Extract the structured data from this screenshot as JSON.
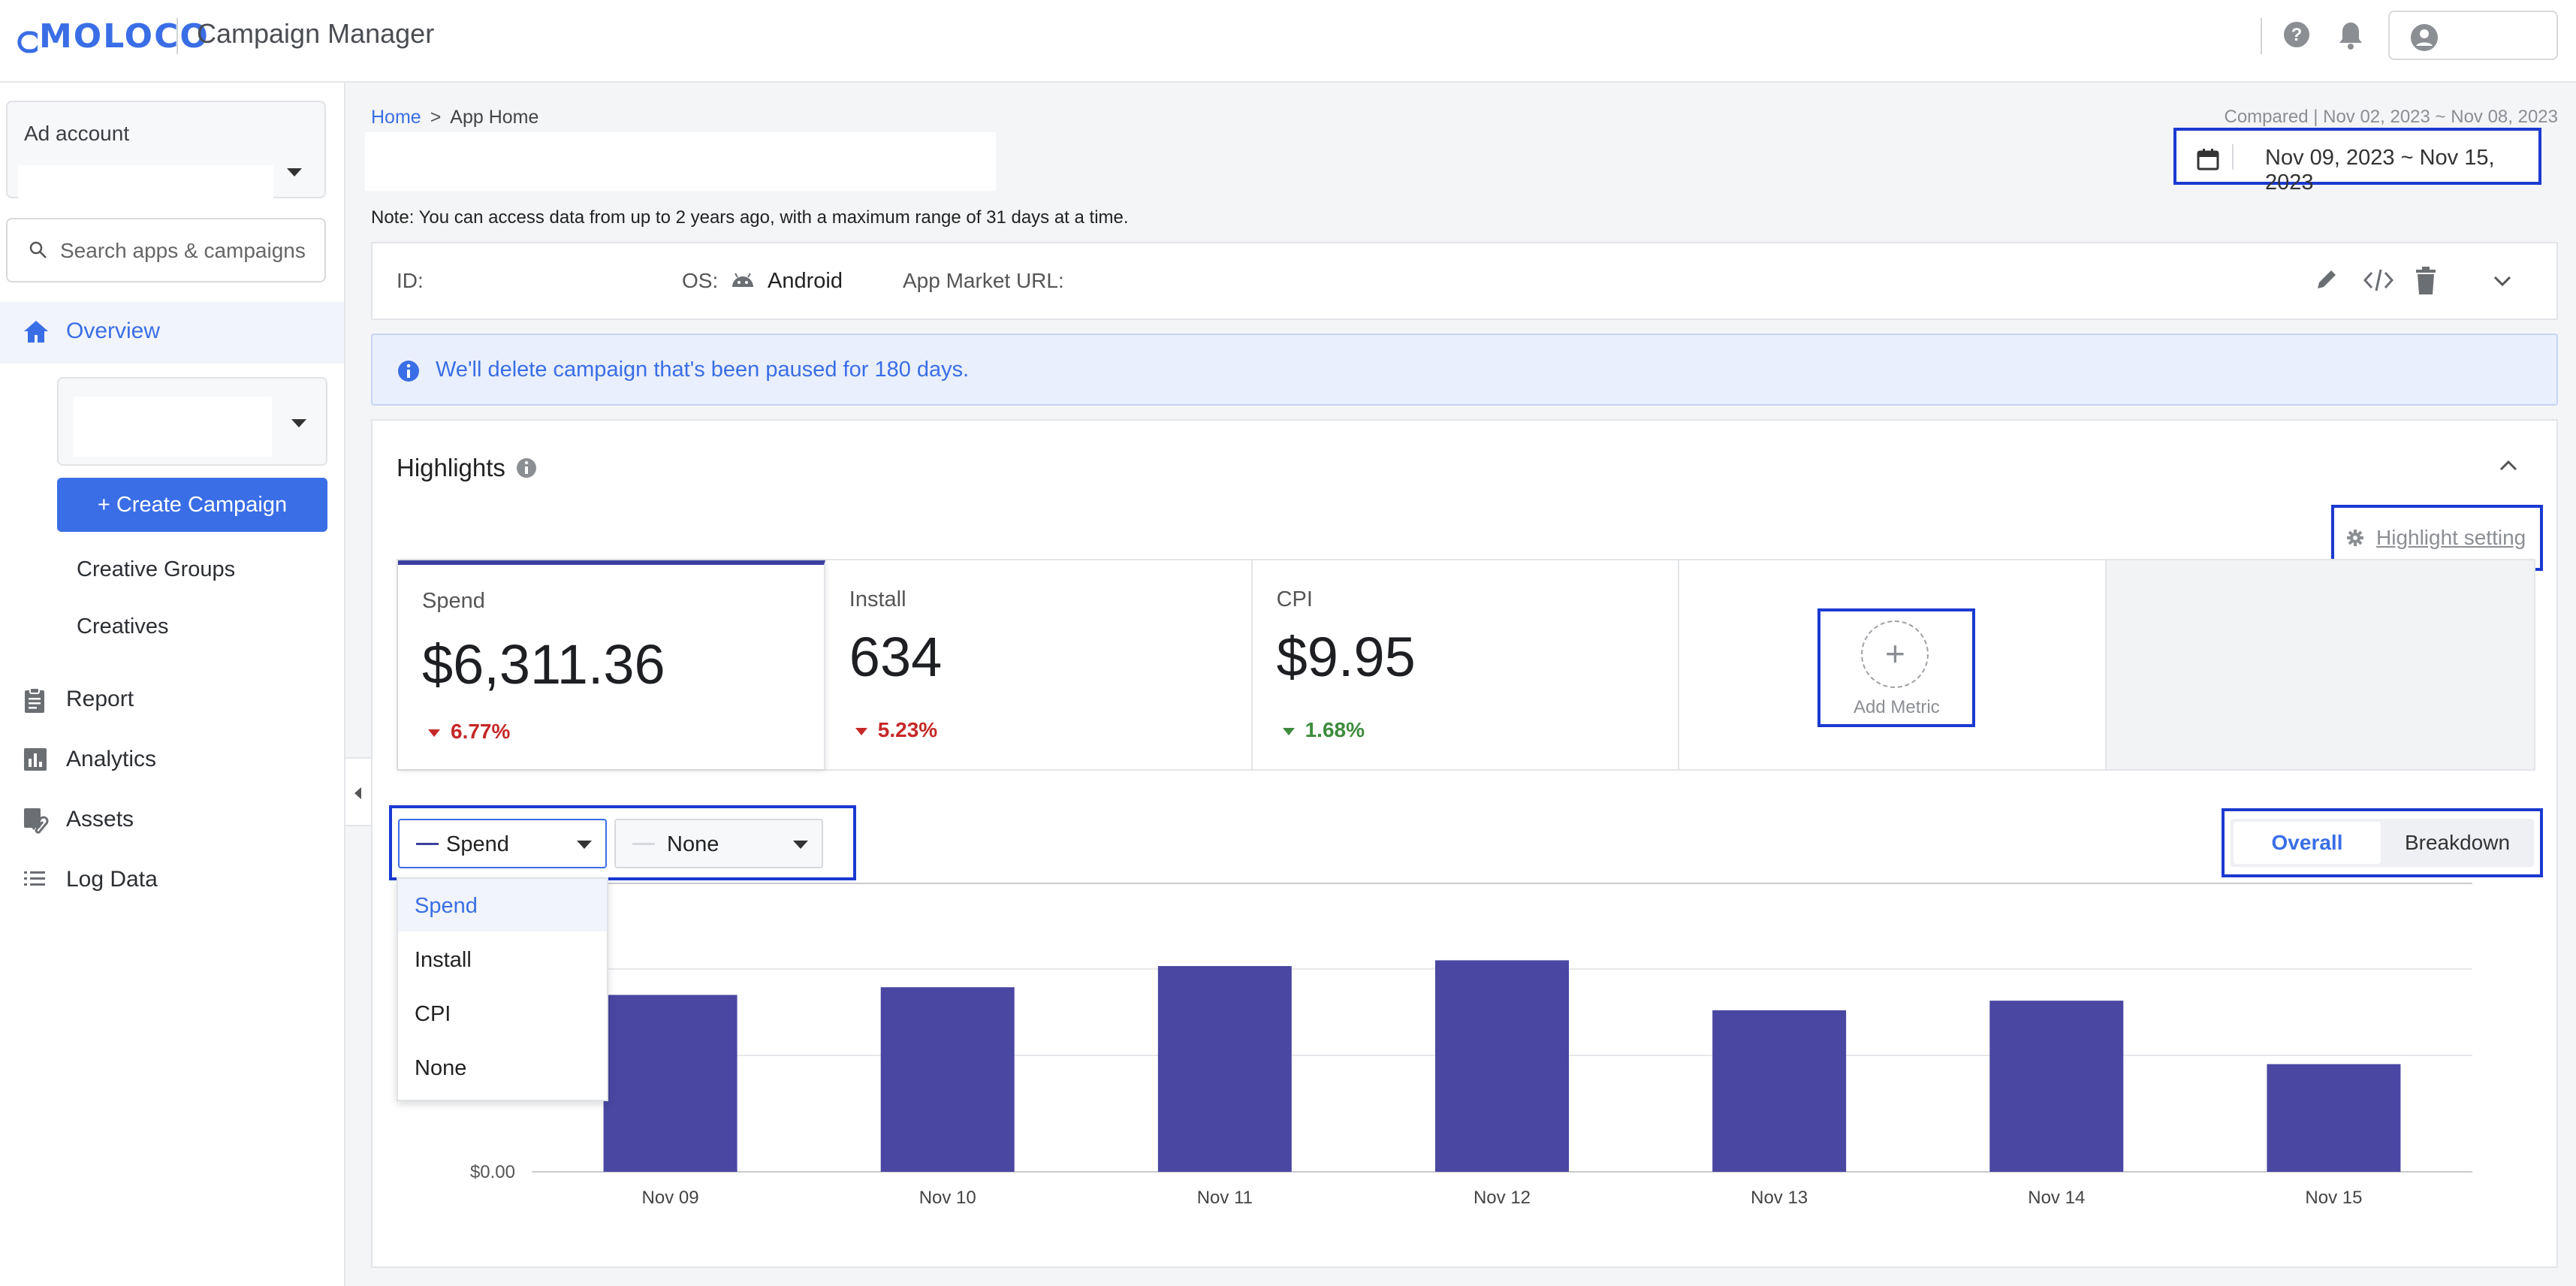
{
  "header": {
    "brand": "MOLOCO",
    "app_title": "Campaign Manager"
  },
  "sidebar": {
    "ad_account_label": "Ad account",
    "search_placeholder": "Search apps & campaigns",
    "overview_label": "Overview",
    "create_campaign_label": "+ Create Campaign",
    "sub_items": [
      "Creative Groups",
      "Creatives"
    ],
    "nav_items": [
      "Report",
      "Analytics",
      "Assets",
      "Log Data"
    ]
  },
  "main": {
    "breadcrumb": {
      "home": "Home",
      "separator": ">",
      "current": "App Home"
    },
    "compared_text": "Compared | Nov 02, 2023 ~ Nov 08, 2023",
    "date_range": "Nov 09, 2023 ~ Nov 15, 2023",
    "note": "Note: You can access data from up to 2 years ago, with a maximum range of 31 days at a time.",
    "app_info": {
      "id_label": "ID:",
      "os_label": "OS:",
      "os_value": "Android",
      "url_label": "App Market URL:"
    },
    "banner_text": "We'll delete campaign that's been paused for 180 days.",
    "highlights": {
      "title": "Highlights",
      "setting_label": "Highlight setting",
      "add_metric_label": "Add Metric",
      "metrics": [
        {
          "label": "Spend",
          "value": "$6,311.36",
          "change": "6.77%",
          "direction": "down",
          "color": "#c62828"
        },
        {
          "label": "Install",
          "value": "634",
          "change": "5.23%",
          "direction": "down",
          "color": "#c62828"
        },
        {
          "label": "CPI",
          "value": "$9.95",
          "change": "1.68%",
          "direction": "up",
          "color": "#3d8b3d"
        }
      ],
      "primary_metric": "Spend",
      "secondary_metric": "None",
      "dropdown_options": [
        "Spend",
        "Install",
        "CPI",
        "None"
      ],
      "view_toggle": {
        "overall": "Overall",
        "breakdown": "Breakdown",
        "selected": "Overall"
      }
    }
  },
  "colors": {
    "accent": "#3a6ee6",
    "bar": "#4a47a3",
    "highlight_outline": "#1b3ad1"
  },
  "chart_data": {
    "type": "bar",
    "categories": [
      "Nov 09",
      "Nov 10",
      "Nov 11",
      "Nov 12",
      "Nov 13",
      "Nov 14",
      "Nov 15"
    ],
    "series": [
      {
        "name": "Spend",
        "values": [
          920,
          960,
          1070,
          1100,
          840,
          890,
          560
        ]
      }
    ],
    "ylim": [
      0,
      1500
    ],
    "y_tick_labels": [
      "$0.00"
    ],
    "grid": true
  }
}
